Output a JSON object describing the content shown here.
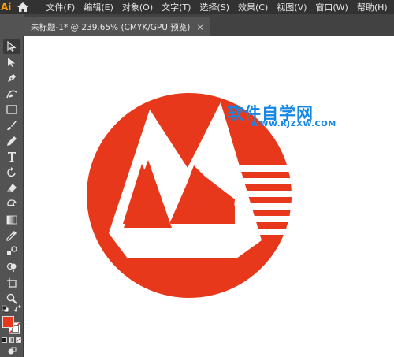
{
  "app": {
    "logo_text": "Ai"
  },
  "menubar": {
    "items": [
      "文件(F)",
      "编辑(E)",
      "对象(O)",
      "文字(T)",
      "选择(S)",
      "效果(C)",
      "视图(V)",
      "窗口(W)",
      "帮助(H)"
    ]
  },
  "document_tab": {
    "title": "未标题-1* @ 239.65% (CMYK/GPU 预览)",
    "close_symbol": "×"
  },
  "tools": [
    "selection-tool",
    "direct-selection-tool",
    "pen-tool",
    "curvature-tool",
    "rectangle-tool",
    "paintbrush-tool",
    "pencil-tool",
    "type-tool",
    "rotate-tool",
    "eraser-tool",
    "warp-tool",
    "gradient-tool",
    "eyedropper-tool",
    "blend-tool",
    "shape-builder-tool",
    "artboard-tool",
    "zoom-tool"
  ],
  "canvas": {
    "logo_color": "#e8381b",
    "watermark": {
      "title": "软件自学网",
      "url": "WWW.RJZXW.COM",
      "color": "#1487e6"
    }
  },
  "colors": {
    "fill": "#e8381b",
    "stroke": "none",
    "ui_dark": "#323232",
    "ui_mid": "#535353"
  }
}
